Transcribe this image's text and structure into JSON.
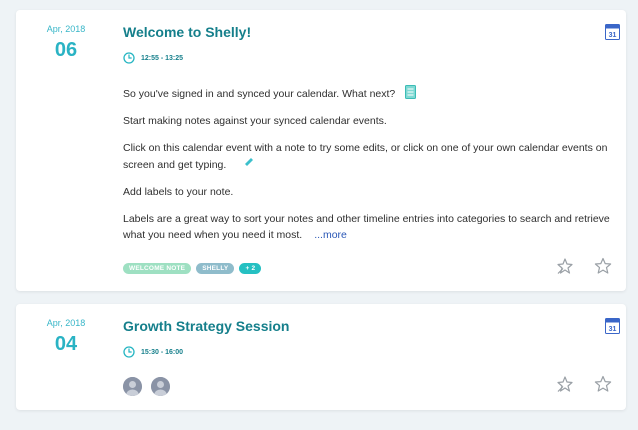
{
  "events": [
    {
      "month": "Apr, 2018",
      "day": "06",
      "title": "Welcome to Shelly!",
      "time": "12:55 - 13:25",
      "paragraphs": [
        "So you've signed in and synced your calendar. What next?",
        "Start making notes against your synced calendar events.",
        "Click on this calendar event with a note to try some edits, or click on one of your own calendar events on screen and get typing.",
        "Add labels to your note.",
        "Labels are a great way to sort your notes and other timeline entries into categories to search and retrieve what you need when you need it most."
      ],
      "more_link": "...more",
      "labels": [
        "WELCOME NOTE",
        "SHELLY",
        "+ 2"
      ],
      "calendar_icon_text": "31"
    },
    {
      "month": "Apr, 2018",
      "day": "04",
      "title": "Growth Strategy Session",
      "time": "15:30 - 16:00",
      "calendar_icon_text": "31"
    }
  ],
  "colors": {
    "accent": "#157f8b",
    "date": "#2ab3c4",
    "link": "#2a57b6",
    "tag_welcome": "#9ee0c2",
    "tag_shelly": "#8fbccb",
    "tag_more": "#25c0c2",
    "calendar": "#3a66c8"
  },
  "icons": {
    "time": "clock-icon",
    "calendar": "google-calendar-icon",
    "note": "notepad-icon",
    "pen": "pen-icon",
    "pin": "pin-icon",
    "favorite": "star-icon"
  }
}
